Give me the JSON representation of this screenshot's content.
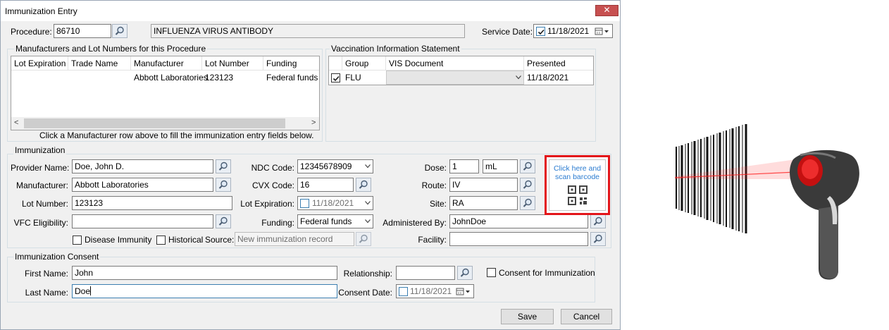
{
  "window": {
    "title": "Immunization Entry",
    "close_glyph": "✕"
  },
  "header": {
    "procedure_label": "Procedure:",
    "procedure_code": "86710",
    "procedure_desc": "INFLUENZA VIRUS ANTIBODY",
    "service_date_label": "Service Date:",
    "service_date": "11/18/2021"
  },
  "manufacturers": {
    "title": "Manufacturers and Lot Numbers for this Procedure",
    "columns": [
      "Lot Expiration",
      "Trade Name",
      "Manufacturer",
      "Lot Number",
      "Funding"
    ],
    "rows": [
      {
        "lot_expiration": "",
        "trade_name": "",
        "manufacturer": "Abbott Laboratories",
        "lot_number": "123123",
        "funding": "Federal funds"
      }
    ],
    "hint": "Click a Manufacturer row above to fill the immunization entry fields below.",
    "scroll_left": "<",
    "scroll_right": ">"
  },
  "vis": {
    "title": "Vaccination Information Statement",
    "columns": [
      "",
      "Group",
      "VIS Document",
      "Presented"
    ],
    "rows": [
      {
        "checked": true,
        "group": "FLU",
        "document": "",
        "presented": "11/18/2021"
      }
    ]
  },
  "immunization": {
    "title": "Immunization",
    "provider_label": "Provider Name:",
    "provider": "Doe, John D.",
    "manufacturer_label": "Manufacturer:",
    "manufacturer": "Abbott Laboratories",
    "lot_label": "Lot Number:",
    "lot": "123123",
    "vfc_label": "VFC Eligibility:",
    "vfc": "",
    "disease_immunity_label": "Disease Immunity",
    "historical_label": "Historical",
    "source_label": "Source:",
    "source_placeholder": "New immunization record",
    "ndc_label": "NDC Code:",
    "ndc": "12345678909",
    "cvx_label": "CVX Code:",
    "cvx": "16",
    "lot_exp_label": "Lot Expiration:",
    "lot_exp": "11/18/2021",
    "funding_label": "Funding:",
    "funding": "Federal funds",
    "dose_label": "Dose:",
    "dose": "1",
    "dose_unit": "mL",
    "route_label": "Route:",
    "route": "IV",
    "site_label": "Site:",
    "site": "RA",
    "administered_label": "Administered By:",
    "administered": "JohnDoe",
    "facility_label": "Facility:",
    "facility": "",
    "scan_text": "Click here and scan barcode"
  },
  "consent": {
    "title": "Immunization Consent",
    "first_label": "First Name:",
    "first": "John",
    "last_label": "Last Name:",
    "last": "Doe",
    "relationship_label": "Relationship:",
    "relationship": "",
    "consent_label": "Consent for Immunization",
    "date_label": "Consent Date:",
    "date": "11/18/2021"
  },
  "buttons": {
    "save": "Save",
    "cancel": "Cancel"
  },
  "icons": [
    "search-icon",
    "calendar-icon",
    "chevron-down-icon",
    "qr-code-icon",
    "barcode-scanner-icon",
    "close-icon"
  ],
  "colors": {
    "highlight": "#e3151a",
    "link": "#2a7bd0",
    "close": "#c75050"
  }
}
